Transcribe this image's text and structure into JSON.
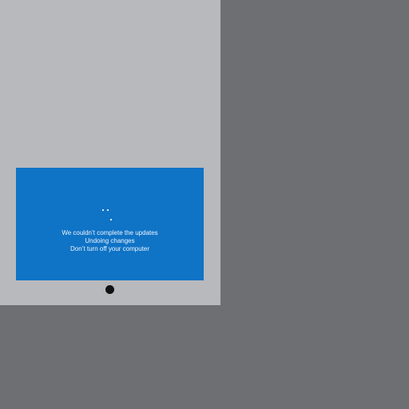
{
  "update_screen": {
    "line_1": "We couldn’t complete the updates",
    "line_2": "Undoing changes",
    "line_3": "Don’t turn off your computer",
    "spinner_icon": "loading-dots-icon"
  },
  "colors": {
    "screen_background": "#0f73c6",
    "screen_text": "#eef5fc",
    "device_frame": "#b8b9bd",
    "backdrop": "#6e6f73",
    "home_button": "#111111"
  }
}
